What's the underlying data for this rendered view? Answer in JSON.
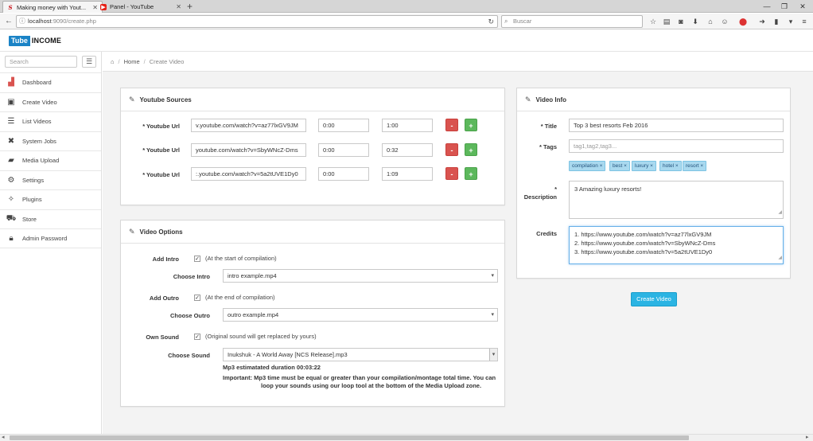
{
  "browser": {
    "tabs": [
      {
        "title": "Making money with Yout...",
        "active": true
      },
      {
        "title": "Panel - YouTube",
        "active": false
      }
    ],
    "url_host": "localhost",
    "url_rest": ":9090/create.php",
    "search_placeholder": "Buscar"
  },
  "brand": {
    "part1": "Tube",
    "part2": "INCOME"
  },
  "sidebar": {
    "search_placeholder": "Search",
    "items": [
      {
        "label": "Dashboard",
        "icon": "signal-icon"
      },
      {
        "label": "Create Video",
        "icon": "film-icon"
      },
      {
        "label": "List Videos",
        "icon": "list-icon"
      },
      {
        "label": "System Jobs",
        "icon": "tools-icon"
      },
      {
        "label": "Media Upload",
        "icon": "folder-icon"
      },
      {
        "label": "Settings",
        "icon": "gear-icon"
      },
      {
        "label": "Plugins",
        "icon": "magic-icon"
      },
      {
        "label": "Store",
        "icon": "cart-icon"
      },
      {
        "label": "Admin Password",
        "icon": "lock-icon"
      }
    ]
  },
  "breadcrumb": {
    "home": "Home",
    "current": "Create Video"
  },
  "sources": {
    "title": "Youtube Sources",
    "rows": [
      {
        "label": "* Youtube Url",
        "url": "v.youtube.com/watch?v=az77lxGV9JM",
        "start": "0:00",
        "end": "1:00"
      },
      {
        "label": "* Youtube Url",
        "url": "youtube.com/watch?v=SbyWNcZ-Dms",
        "start": "0:00",
        "end": "0:32"
      },
      {
        "label": "* Youtube Url",
        "url": ":.youtube.com/watch?v=5a2tUVE1Dy0",
        "start": "0:00",
        "end": "1:09"
      }
    ],
    "minus": "-",
    "plus": "+"
  },
  "options": {
    "title": "Video Options",
    "add_intro": "Add Intro",
    "intro_hint": "(At the start of compilation)",
    "choose_intro": "Choose Intro",
    "intro_value": "intro example.mp4",
    "add_outro": "Add Outro",
    "outro_hint": "(At the end of compilation)",
    "choose_outro": "Choose Outro",
    "outro_value": "outro example.mp4",
    "own_sound": "Own Sound",
    "own_sound_hint": "(Original sound will get replaced by yours)",
    "choose_sound": "Choose Sound",
    "sound_value": "Inukshuk - A World Away [NCS Release].mp3",
    "duration": "Mp3 estimatated duration 00:03:22",
    "important_1": "Important: Mp3 time must be equal or greater than your compilation/montage total time. You can",
    "important_2": "loop your sounds using our loop tool at the bottom of the Media Upload zone.",
    "check": "✓"
  },
  "info": {
    "title": "Video Info",
    "title_label": "* Title",
    "title_value": "Top 3 best resorts Feb 2016",
    "tags_label": "* Tags",
    "tags_placeholder": "tag1,tag2,tag3...",
    "tags": [
      "compilation ×",
      "best ×",
      "luxury ×",
      "hotel ×",
      "resort ×"
    ],
    "desc_label_star": "*",
    "desc_label": "Description",
    "desc_value": "3 Amazing luxury resorts!",
    "credits_label": "Credits",
    "credits": [
      "1. https://www.youtube.com/watch?v=az77lxGV9JM",
      "2. https://www.youtube.com/watch?v=SbyWNcZ-Dms",
      "3. https://www.youtube.com/watch?v=5a2tUVE1Dy0"
    ],
    "create_button": "Create Video"
  }
}
